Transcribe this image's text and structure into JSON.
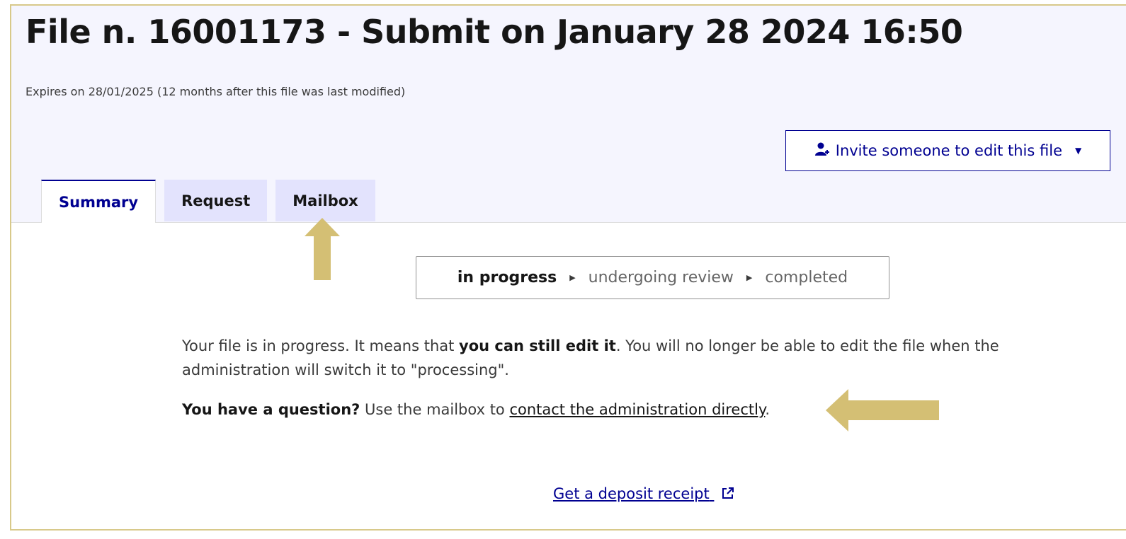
{
  "header": {
    "title": "File n. 16001173 - Submit on January 28 2024 16:50",
    "expires": "Expires on 28/01/2025 (12 months after this file was last modified)",
    "invite_button_label": "Invite someone to edit this file"
  },
  "tabs": [
    {
      "label": "Summary",
      "active": true
    },
    {
      "label": "Request",
      "active": false
    },
    {
      "label": "Mailbox",
      "active": false
    }
  ],
  "status_steps": {
    "current": "in progress",
    "next": "undergoing review",
    "last": "completed"
  },
  "info": {
    "p1_start": "Your file is in progress. It means that ",
    "p1_bold": "you can still edit it",
    "p1_end": ". You will no longer be able to edit the file when the administration will switch it to \"processing\".",
    "p2_bold": "You have a question?",
    "p2_middle": " Use the mailbox to ",
    "p2_link": "contact the administration directly",
    "p2_end": "."
  },
  "receipt_link": "Get a deposit receipt",
  "colors": {
    "primary": "#000091",
    "header_bg": "#f5f5fe",
    "tab_bg": "#e3e3fd",
    "annotation_arrow": "#d4bf74",
    "frame_border": "#d8c98a"
  }
}
